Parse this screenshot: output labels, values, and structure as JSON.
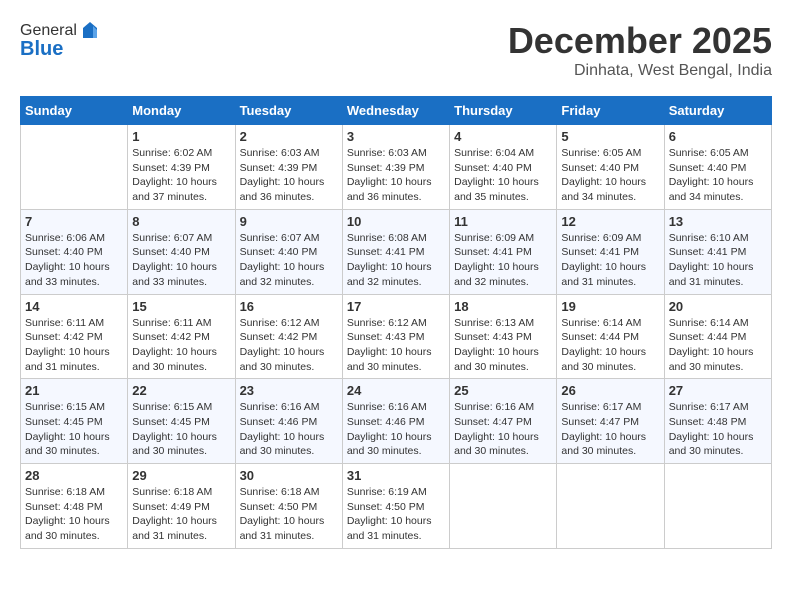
{
  "header": {
    "logo_line1": "General",
    "logo_line2": "Blue",
    "month": "December 2025",
    "location": "Dinhata, West Bengal, India"
  },
  "weekdays": [
    "Sunday",
    "Monday",
    "Tuesday",
    "Wednesday",
    "Thursday",
    "Friday",
    "Saturday"
  ],
  "weeks": [
    [
      {
        "day": "",
        "info": ""
      },
      {
        "day": "1",
        "info": "Sunrise: 6:02 AM\nSunset: 4:39 PM\nDaylight: 10 hours\nand 37 minutes."
      },
      {
        "day": "2",
        "info": "Sunrise: 6:03 AM\nSunset: 4:39 PM\nDaylight: 10 hours\nand 36 minutes."
      },
      {
        "day": "3",
        "info": "Sunrise: 6:03 AM\nSunset: 4:39 PM\nDaylight: 10 hours\nand 36 minutes."
      },
      {
        "day": "4",
        "info": "Sunrise: 6:04 AM\nSunset: 4:40 PM\nDaylight: 10 hours\nand 35 minutes."
      },
      {
        "day": "5",
        "info": "Sunrise: 6:05 AM\nSunset: 4:40 PM\nDaylight: 10 hours\nand 34 minutes."
      },
      {
        "day": "6",
        "info": "Sunrise: 6:05 AM\nSunset: 4:40 PM\nDaylight: 10 hours\nand 34 minutes."
      }
    ],
    [
      {
        "day": "7",
        "info": "Sunrise: 6:06 AM\nSunset: 4:40 PM\nDaylight: 10 hours\nand 33 minutes."
      },
      {
        "day": "8",
        "info": "Sunrise: 6:07 AM\nSunset: 4:40 PM\nDaylight: 10 hours\nand 33 minutes."
      },
      {
        "day": "9",
        "info": "Sunrise: 6:07 AM\nSunset: 4:40 PM\nDaylight: 10 hours\nand 32 minutes."
      },
      {
        "day": "10",
        "info": "Sunrise: 6:08 AM\nSunset: 4:41 PM\nDaylight: 10 hours\nand 32 minutes."
      },
      {
        "day": "11",
        "info": "Sunrise: 6:09 AM\nSunset: 4:41 PM\nDaylight: 10 hours\nand 32 minutes."
      },
      {
        "day": "12",
        "info": "Sunrise: 6:09 AM\nSunset: 4:41 PM\nDaylight: 10 hours\nand 31 minutes."
      },
      {
        "day": "13",
        "info": "Sunrise: 6:10 AM\nSunset: 4:41 PM\nDaylight: 10 hours\nand 31 minutes."
      }
    ],
    [
      {
        "day": "14",
        "info": "Sunrise: 6:11 AM\nSunset: 4:42 PM\nDaylight: 10 hours\nand 31 minutes."
      },
      {
        "day": "15",
        "info": "Sunrise: 6:11 AM\nSunset: 4:42 PM\nDaylight: 10 hours\nand 30 minutes."
      },
      {
        "day": "16",
        "info": "Sunrise: 6:12 AM\nSunset: 4:42 PM\nDaylight: 10 hours\nand 30 minutes."
      },
      {
        "day": "17",
        "info": "Sunrise: 6:12 AM\nSunset: 4:43 PM\nDaylight: 10 hours\nand 30 minutes."
      },
      {
        "day": "18",
        "info": "Sunrise: 6:13 AM\nSunset: 4:43 PM\nDaylight: 10 hours\nand 30 minutes."
      },
      {
        "day": "19",
        "info": "Sunrise: 6:14 AM\nSunset: 4:44 PM\nDaylight: 10 hours\nand 30 minutes."
      },
      {
        "day": "20",
        "info": "Sunrise: 6:14 AM\nSunset: 4:44 PM\nDaylight: 10 hours\nand 30 minutes."
      }
    ],
    [
      {
        "day": "21",
        "info": "Sunrise: 6:15 AM\nSunset: 4:45 PM\nDaylight: 10 hours\nand 30 minutes."
      },
      {
        "day": "22",
        "info": "Sunrise: 6:15 AM\nSunset: 4:45 PM\nDaylight: 10 hours\nand 30 minutes."
      },
      {
        "day": "23",
        "info": "Sunrise: 6:16 AM\nSunset: 4:46 PM\nDaylight: 10 hours\nand 30 minutes."
      },
      {
        "day": "24",
        "info": "Sunrise: 6:16 AM\nSunset: 4:46 PM\nDaylight: 10 hours\nand 30 minutes."
      },
      {
        "day": "25",
        "info": "Sunrise: 6:16 AM\nSunset: 4:47 PM\nDaylight: 10 hours\nand 30 minutes."
      },
      {
        "day": "26",
        "info": "Sunrise: 6:17 AM\nSunset: 4:47 PM\nDaylight: 10 hours\nand 30 minutes."
      },
      {
        "day": "27",
        "info": "Sunrise: 6:17 AM\nSunset: 4:48 PM\nDaylight: 10 hours\nand 30 minutes."
      }
    ],
    [
      {
        "day": "28",
        "info": "Sunrise: 6:18 AM\nSunset: 4:48 PM\nDaylight: 10 hours\nand 30 minutes."
      },
      {
        "day": "29",
        "info": "Sunrise: 6:18 AM\nSunset: 4:49 PM\nDaylight: 10 hours\nand 31 minutes."
      },
      {
        "day": "30",
        "info": "Sunrise: 6:18 AM\nSunset: 4:50 PM\nDaylight: 10 hours\nand 31 minutes."
      },
      {
        "day": "31",
        "info": "Sunrise: 6:19 AM\nSunset: 4:50 PM\nDaylight: 10 hours\nand 31 minutes."
      },
      {
        "day": "",
        "info": ""
      },
      {
        "day": "",
        "info": ""
      },
      {
        "day": "",
        "info": ""
      }
    ]
  ]
}
